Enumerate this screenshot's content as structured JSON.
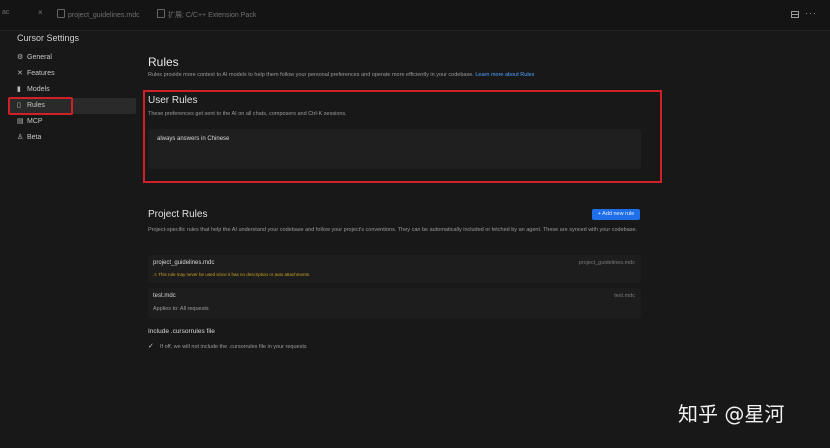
{
  "tabs": {
    "edge_label": "ac",
    "close_glyph": "×",
    "items": [
      {
        "label": "project_guidelines.mdc"
      },
      {
        "label": "扩展: C/C++ Extension Pack"
      }
    ]
  },
  "topright": {
    "more_glyph": "···"
  },
  "sidebar": {
    "title": "Cursor Settings",
    "items": [
      {
        "label": "General",
        "icon": "gear-icon",
        "glyph": "⚙"
      },
      {
        "label": "Features",
        "icon": "tools-icon",
        "glyph": "✕"
      },
      {
        "label": "Models",
        "icon": "chart-icon",
        "glyph": "▮"
      },
      {
        "label": "Rules",
        "icon": "document-icon",
        "glyph": "▯"
      },
      {
        "label": "MCP",
        "icon": "server-icon",
        "glyph": "▤"
      },
      {
        "label": "Beta",
        "icon": "flask-icon",
        "glyph": "♙"
      }
    ],
    "active": "Rules"
  },
  "main": {
    "title": "Rules",
    "description": "Rules provide more context to AI models to help them follow your personal preferences and operate more efficiently in your codebase.",
    "learn_more": "Learn more about Rules",
    "user_rules": {
      "title": "User Rules",
      "description": "These preferences get sent to the AI on all chats, composers and Ctrl-K sessions.",
      "value": "always answers in Chinese"
    },
    "project_rules": {
      "title": "Project Rules",
      "add_button": "+ Add new rule",
      "description": "Project-specific rules that help the AI understand your codebase and follow your project's conventions. They can be automatically included or fetched by an agent. These are synced with your codebase.",
      "rules": [
        {
          "name": "project_guidelines.mdc",
          "path": "project_guidelines.mdc",
          "warning": "⚠ This rule may never be used since it has no description or auto attachments."
        },
        {
          "name": "test.mdc",
          "path": "test.mdc",
          "subtitle": "Applies to: All requests"
        }
      ]
    },
    "include": {
      "title": "Include .cursorrules file",
      "check_glyph": "✓",
      "description": "If off, we will not include the .cursorrules file in your requests"
    }
  },
  "watermark": "知乎 @星河",
  "colors": {
    "accent": "#1f6feb",
    "highlight": "#d0202a",
    "warning": "#c9a227",
    "link": "#4da3ff"
  }
}
